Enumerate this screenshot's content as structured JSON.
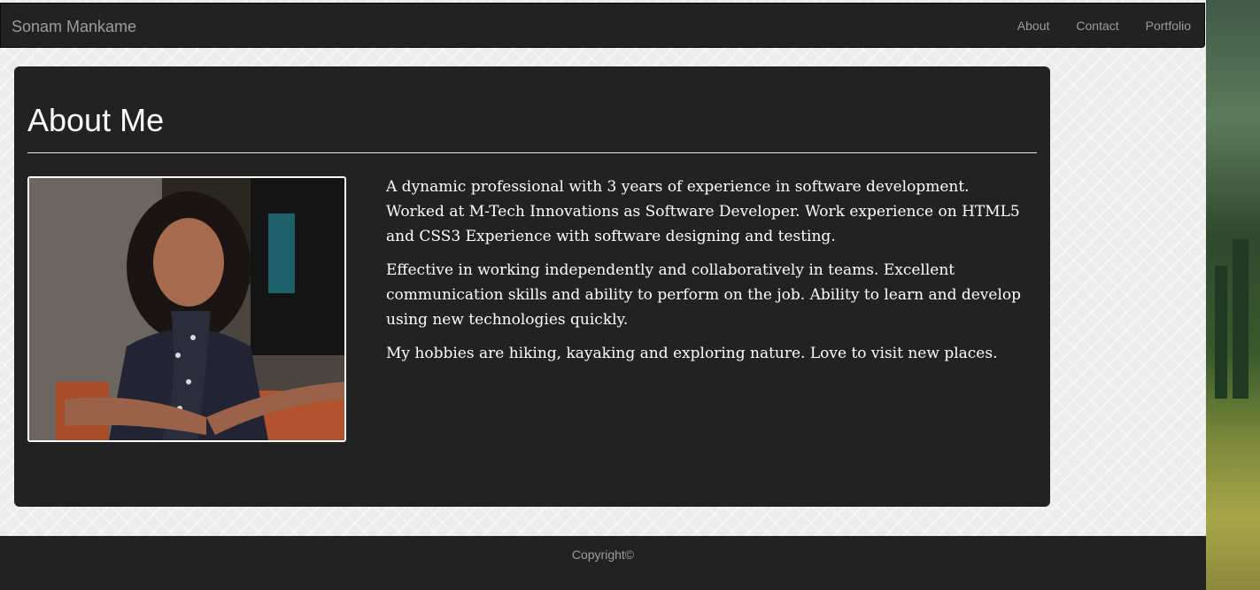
{
  "navbar": {
    "brand": "Sonam Mankame",
    "links": [
      "About",
      "Contact",
      "Portfolio"
    ]
  },
  "about": {
    "heading": "About Me",
    "photo_alt": "Profile photo",
    "paragraphs": [
      "A dynamic professional with 3 years of experience in software development. Worked at M-Tech Innovations as Software Developer. Work experience on HTML5 and CSS3 Experience with software designing and testing.",
      "Effective in working independently and collaboratively in teams. Excellent communication skills and ability to perform on the job. Ability to learn and develop using new technologies quickly.",
      "My hobbies are hiking, kayaking and exploring nature. Love to visit new places."
    ]
  },
  "footer": {
    "copyright": "Copyright©"
  },
  "colors": {
    "navbar_bg": "#222222",
    "card_bg": "#222222",
    "nav_text": "#9d9d9d",
    "body_text": "#ffffff"
  }
}
